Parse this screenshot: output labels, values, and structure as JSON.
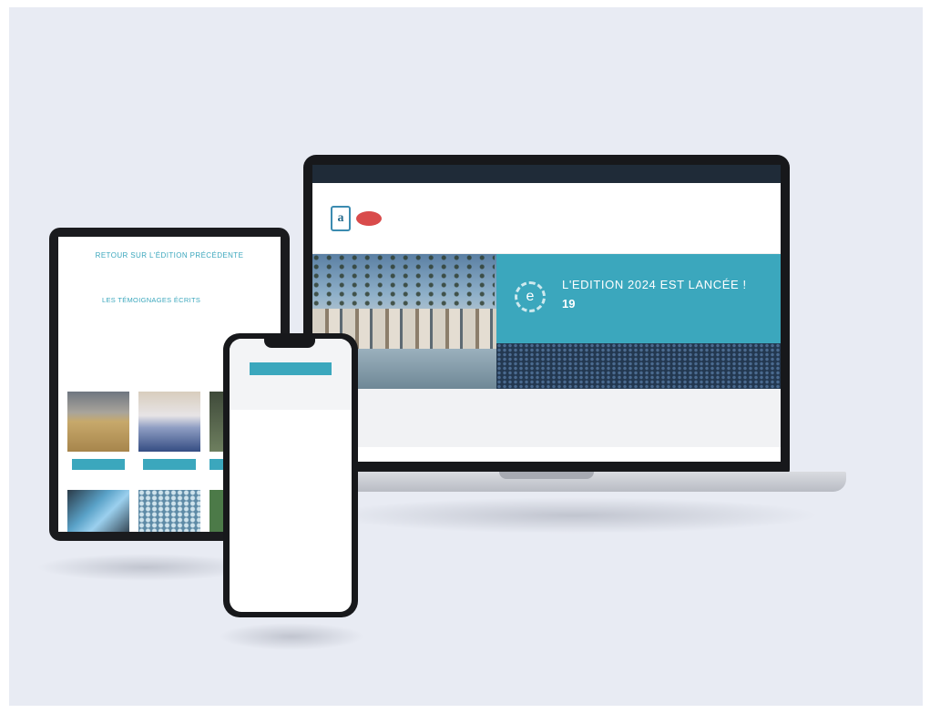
{
  "colors": {
    "accent": "#3ba7bd",
    "background": "#e8ebf3",
    "device": "#17181b"
  },
  "laptop": {
    "topbar": {
      "phone": "",
      "email": ""
    },
    "nav": [],
    "hero": {
      "title": "L'EDITION 2024 EST LANCÉE !",
      "number": "19",
      "tagline": "",
      "dates": "",
      "emblem_icon": "gear-badge-icon"
    },
    "stats": {
      "countdown_label": "",
      "countdown_value": "",
      "items": []
    }
  },
  "tablet": {
    "title": "RETOUR SUR L'ÉDITION PRÉCÉDENTE",
    "description": "",
    "grid": [],
    "subtitle": "LES TÉMOIGNAGES ÉCRITS",
    "buttons": []
  },
  "phone": {
    "button": "",
    "label": "",
    "items": []
  }
}
